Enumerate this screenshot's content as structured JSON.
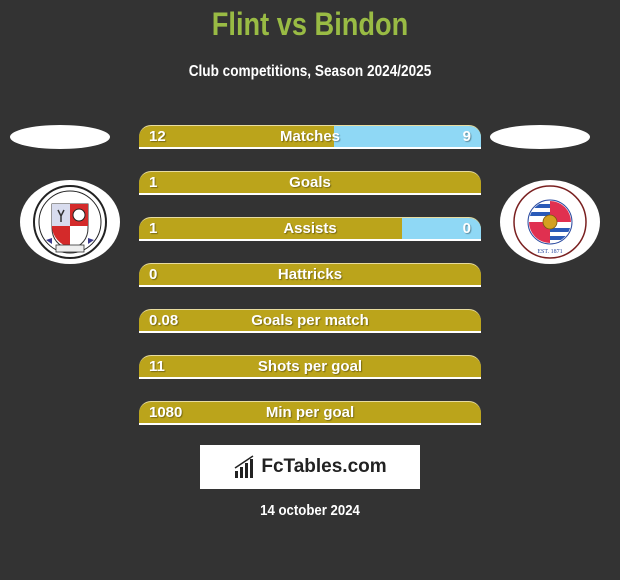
{
  "header": {
    "title": "Flint vs Bindon",
    "subtitle": "Club competitions, Season 2024/2025"
  },
  "teams": {
    "left": {
      "name": "Flint",
      "crest": "Crawley Town FC",
      "crest_text_top": "CRAWLEY TOWN FC",
      "crest_text_bottom": "RED DEVILS"
    },
    "right": {
      "name": "Bindon",
      "crest": "Reading Football Club",
      "crest_text_top": "READING FOOTBALL CLUB",
      "crest_text_bottom": "EST. 1871"
    }
  },
  "colors": {
    "left_bar": "#bba41b",
    "right_bar": "#8fd8f5",
    "title": "#99bb44",
    "background": "#333333"
  },
  "stats": [
    {
      "label": "Matches",
      "left": "12",
      "right": "9",
      "right_share": 0.43
    },
    {
      "label": "Goals",
      "left": "1",
      "right": "",
      "right_share": 0
    },
    {
      "label": "Assists",
      "left": "1",
      "right": "0",
      "right_share": 0.23
    },
    {
      "label": "Hattricks",
      "left": "0",
      "right": "",
      "right_share": 0
    },
    {
      "label": "Goals per match",
      "left": "0.08",
      "right": "",
      "right_share": 0
    },
    {
      "label": "Shots per goal",
      "left": "11",
      "right": "",
      "right_share": 0
    },
    {
      "label": "Min per goal",
      "left": "1080",
      "right": "",
      "right_share": 0
    }
  ],
  "brand": {
    "icon": "bar-chart-icon",
    "text": "FcTables.com"
  },
  "date": "14 october 2024"
}
